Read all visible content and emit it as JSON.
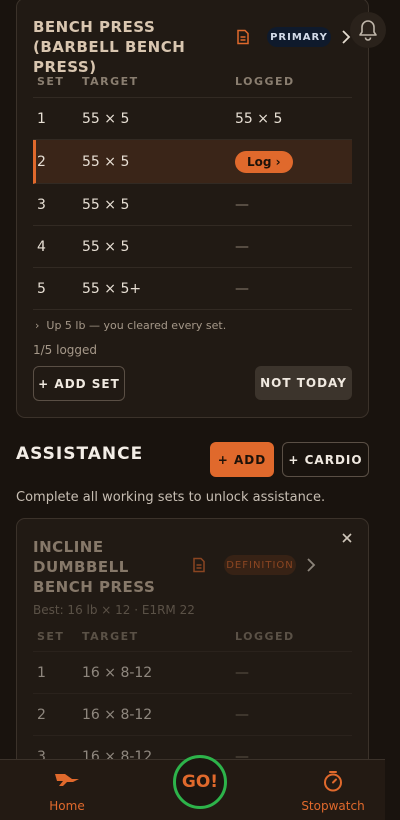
{
  "primary_exercise": {
    "title": "BENCH PRESS (BARBELL BENCH PRESS)",
    "badge": "PRIMARY",
    "columns": {
      "set": "SET",
      "target": "TARGET",
      "logged": "LOGGED"
    },
    "sets": [
      {
        "set": "1",
        "target": "55 × 5",
        "logged": "55 × 5"
      },
      {
        "set": "2",
        "target": "55 × 5",
        "logged": "Log ›",
        "active": true
      },
      {
        "set": "3",
        "target": "55 × 5",
        "logged": "—"
      },
      {
        "set": "4",
        "target": "55 × 5",
        "logged": "—"
      },
      {
        "set": "5",
        "target": "55 × 5+",
        "logged": "—"
      }
    ],
    "hint": "Up 5 lb — you cleared every set.",
    "progress": "1/5 logged",
    "add_set_label": "+ ADD SET",
    "not_today_label": "NOT TODAY"
  },
  "assistance": {
    "title": "ASSISTANCE",
    "add_label": "+ ADD",
    "cardio_label": "+ CARDIO",
    "lock_message": "Complete all working sets to unlock assistance.",
    "exercise": {
      "title": "INCLINE DUMBBELL BENCH PRESS",
      "badge": "DEFINITION",
      "best": "Best: 16 lb × 12 · E1RM 22",
      "columns": {
        "set": "SET",
        "target": "TARGET",
        "logged": "LOGGED"
      },
      "sets": [
        {
          "set": "1",
          "target": "16 × 8-12",
          "logged": "—"
        },
        {
          "set": "2",
          "target": "16 × 8-12",
          "logged": "—"
        },
        {
          "set": "3",
          "target": "16 × 8-12",
          "logged": "—"
        }
      ]
    }
  },
  "nav": {
    "home_label": "Home",
    "go_label": "GO!",
    "stopwatch_label": "Stopwatch"
  },
  "colors": {
    "accent": "#e0692c",
    "go_ring": "#2db34a",
    "background": "#19130e"
  }
}
